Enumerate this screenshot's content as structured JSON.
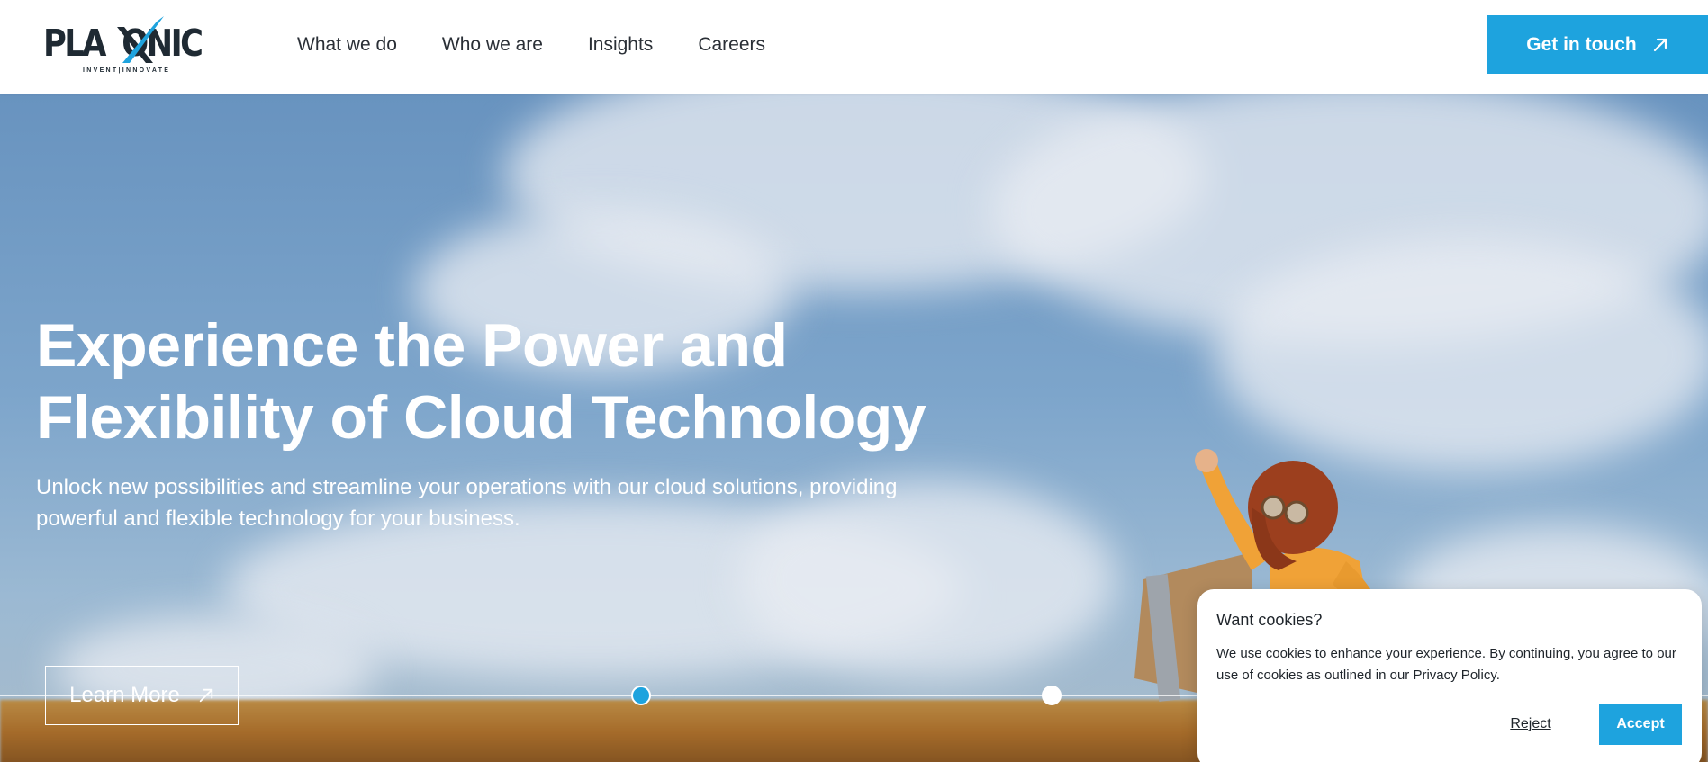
{
  "header": {
    "logo": {
      "name": "PLAXONIC",
      "tagline": "INVENT|INNOVATE",
      "icon": "plaxonic-logo"
    },
    "nav": [
      {
        "label": "What we do"
      },
      {
        "label": "Who we are"
      },
      {
        "label": "Insights"
      },
      {
        "label": "Careers"
      }
    ],
    "cta": {
      "label": "Get in touch",
      "icon": "arrow-up-right-icon"
    }
  },
  "hero": {
    "title_lines": [
      "Experience the Power and",
      "Flexibility of Cloud Technology"
    ],
    "subtitle_lines": [
      "Unlock new possibilities and streamline your operations with our cloud solutions, providing",
      "powerful and flexible technology for your business."
    ],
    "learn_more": {
      "label": "Learn More",
      "icon": "arrow-up-right-icon"
    },
    "slider": {
      "total": 2,
      "active_index": 0
    }
  },
  "cookie_banner": {
    "title": "Want cookies?",
    "text": "We use cookies to enhance your experience. By continuing, you agree to our use of cookies as outlined in our Privacy Policy.",
    "reject_label": "Reject",
    "accept_label": "Accept"
  },
  "colors": {
    "accent": "#1ea3de",
    "text_dark": "#1f252b",
    "header_bg": "#ffffff"
  }
}
